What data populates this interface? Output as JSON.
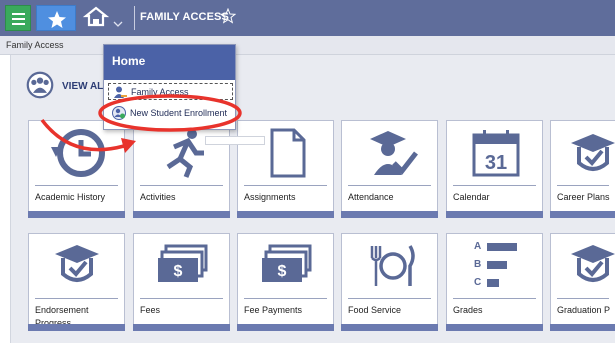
{
  "topbar": {
    "menu_icon": "hamburger-menu-icon",
    "favorites_icon": "star-icon",
    "home_icon": "home-icon",
    "title": "FAMILY ACCESS",
    "favorite_toggle_icon": "star-outline-icon"
  },
  "breadcrumb": "Family Access",
  "view_all": {
    "label": "VIEW AL",
    "icon": "student-group-icon"
  },
  "dropdown": {
    "title": "Home",
    "items": [
      {
        "label": "Family Access",
        "icon": "person-icon"
      },
      {
        "label": "New Student Enrollment",
        "icon": "person-add-icon"
      }
    ]
  },
  "tiles_row1": [
    {
      "label": "Academic History",
      "icon": "history-clock-icon"
    },
    {
      "label": "Activities",
      "icon": "runner-icon"
    },
    {
      "label": "Assignments",
      "icon": "document-icon"
    },
    {
      "label": "Attendance",
      "icon": "graduate-check-icon"
    },
    {
      "label": "Calendar",
      "icon": "calendar-icon",
      "calendar_day": "31"
    },
    {
      "label": "Career Plans",
      "icon": "grad-cap-badge-icon"
    }
  ],
  "tiles_row2": [
    {
      "label": "Endorsement Progress",
      "icon": "grad-cap-badge-icon"
    },
    {
      "label": "Fees",
      "icon": "dollar-bills-icon"
    },
    {
      "label": "Fee Payments",
      "icon": "dollar-bills-icon"
    },
    {
      "label": "Food Service",
      "icon": "fork-plate-knife-icon"
    },
    {
      "label": "Grades",
      "icon": "grade-bars-icon",
      "grade_letters": [
        "A",
        "B",
        "C"
      ]
    },
    {
      "label": "Graduation P",
      "icon": "grad-cap-badge-icon"
    }
  ],
  "colors": {
    "topbar": "#5f6d9b",
    "menu_button": "#3aa95c",
    "star_button": "#4f8fe0",
    "tile_bar": "#6b7ab0",
    "icon": "#5a6996",
    "annotation_red": "#e8332c"
  }
}
